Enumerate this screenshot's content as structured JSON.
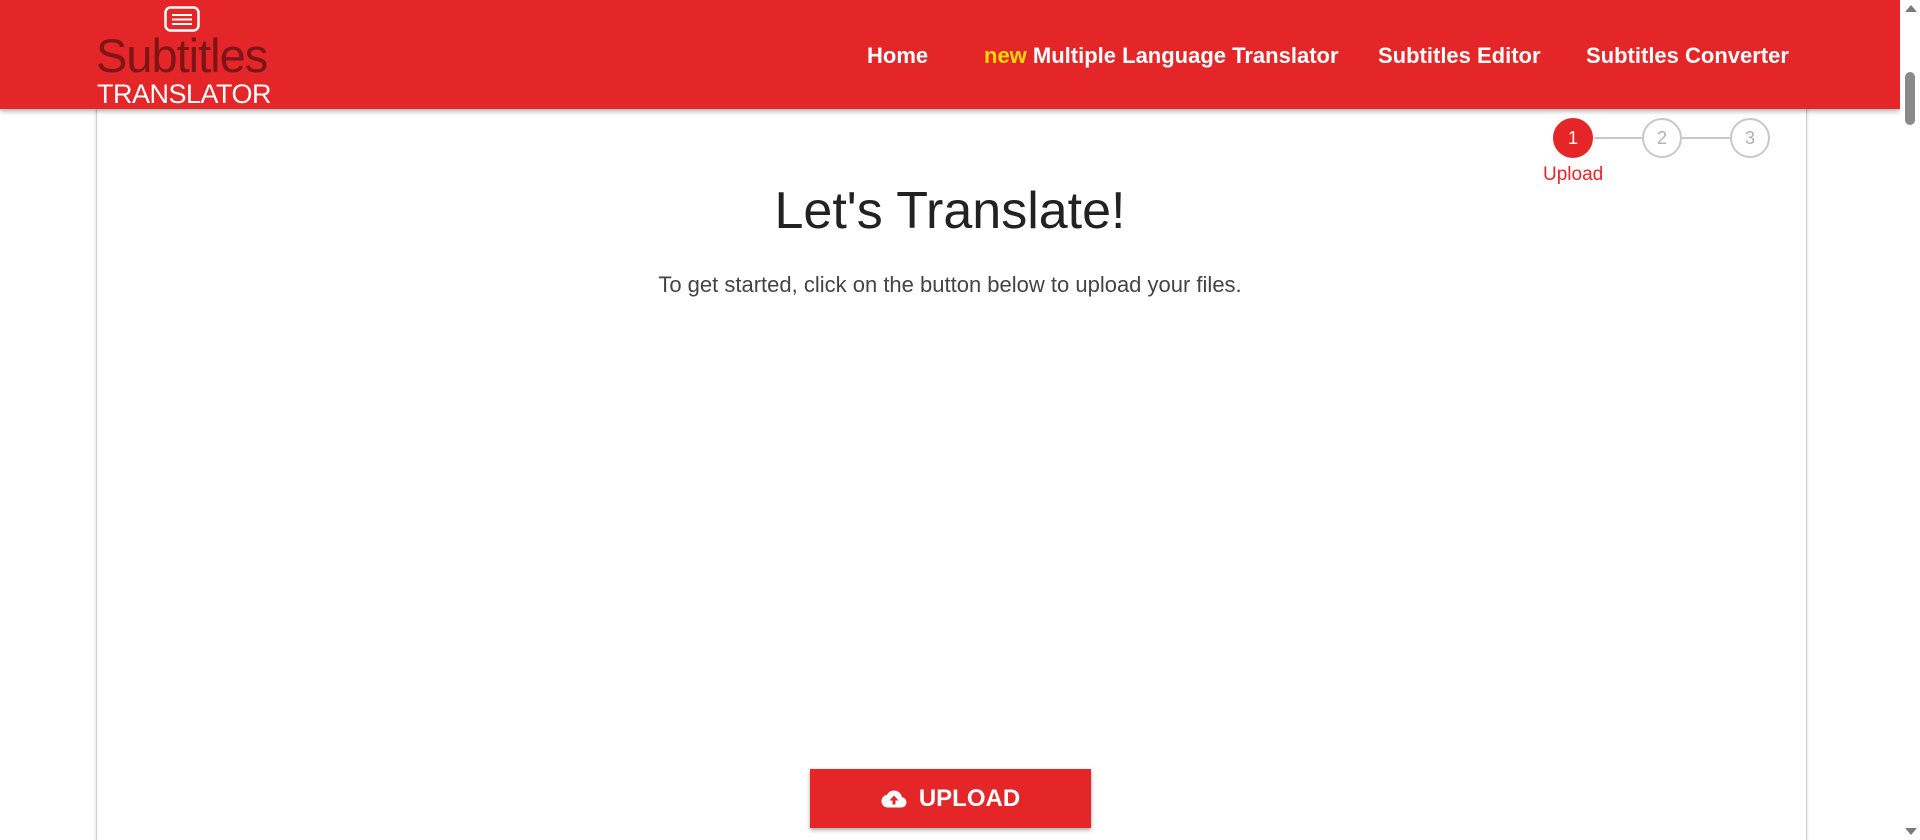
{
  "header": {
    "logo": {
      "title": "Subtitles",
      "subtitle": "TRANSLATOR",
      "icon": "subtitles-icon"
    },
    "nav": [
      {
        "label": "Home"
      },
      {
        "badge": "new",
        "label": "Multiple Language Translator"
      },
      {
        "label": "Subtitles Editor"
      },
      {
        "label": "Subtitles Converter"
      }
    ]
  },
  "stepper": {
    "steps": [
      {
        "number": "1",
        "label": "Upload",
        "active": true
      },
      {
        "number": "2",
        "active": false
      },
      {
        "number": "3",
        "active": false
      }
    ]
  },
  "main": {
    "heading": "Let's Translate!",
    "description": "To get started, click on the button below to upload your files.",
    "upload_button": {
      "label": "UPLOAD",
      "icon": "cloud-upload-icon"
    }
  },
  "colors": {
    "brand_red": "#e52629",
    "logo_dark_red": "#7d1416",
    "new_badge": "#ffd700"
  }
}
